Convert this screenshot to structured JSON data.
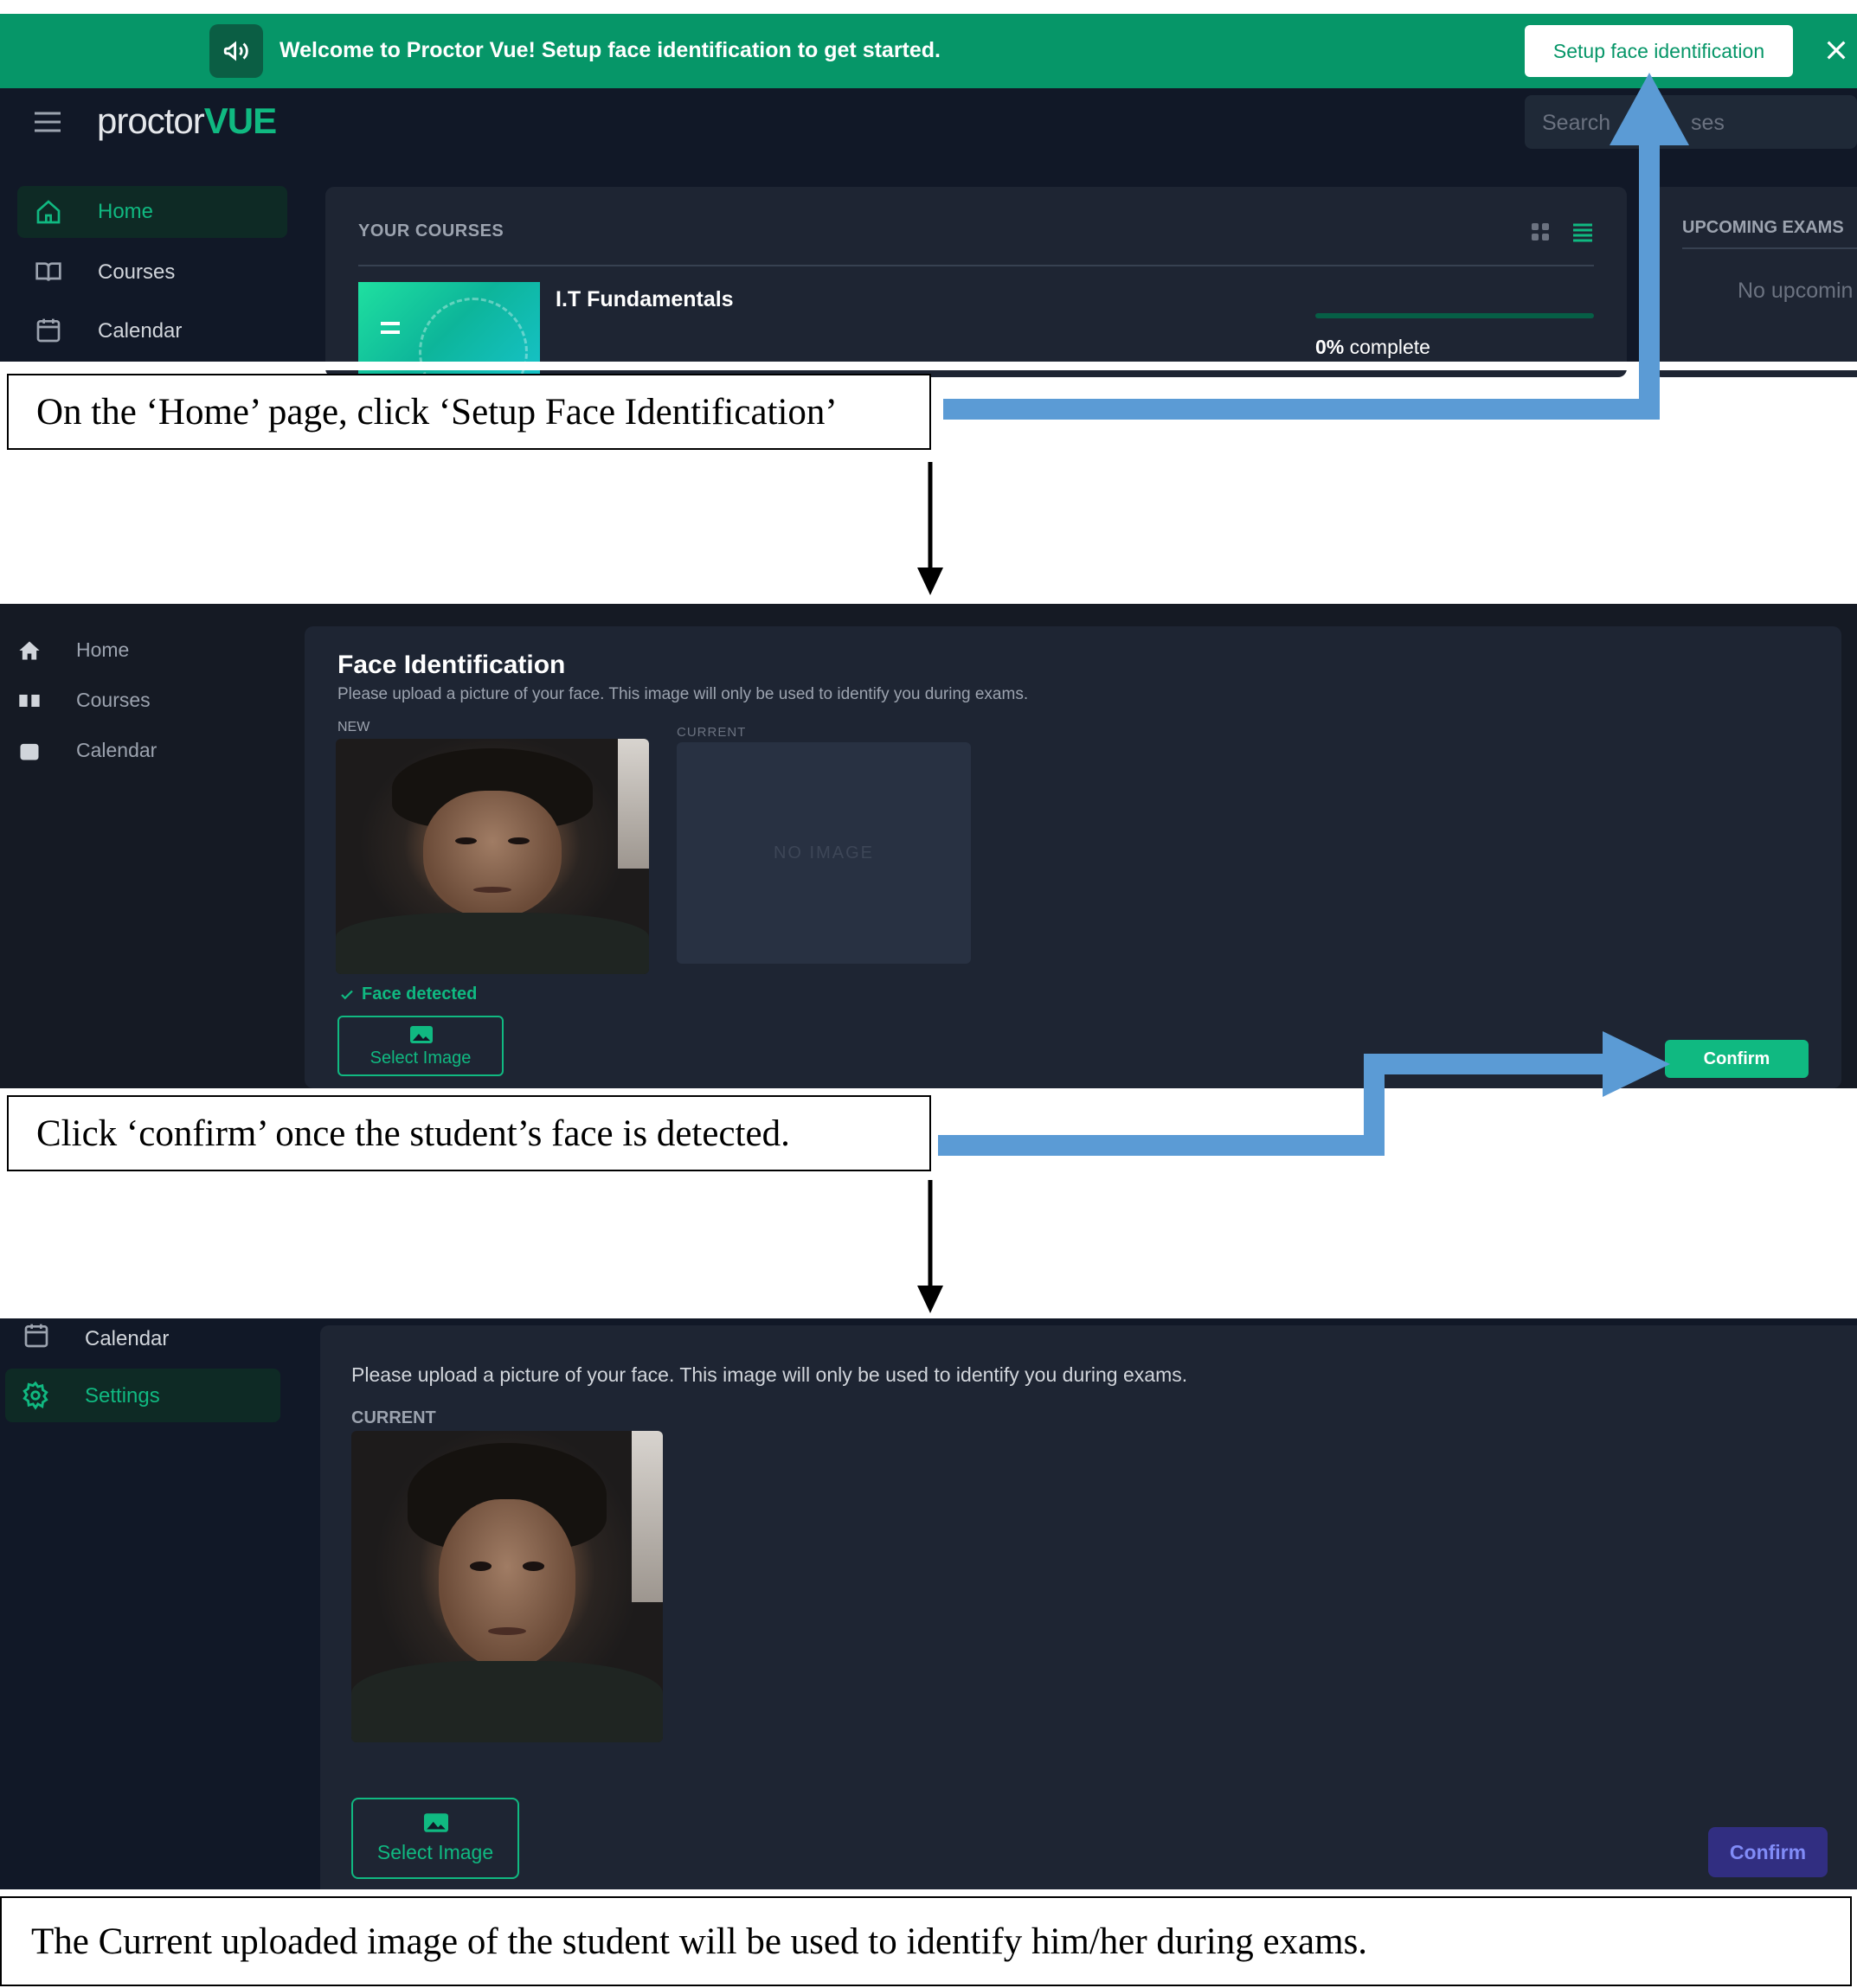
{
  "section1": {
    "banner": {
      "text": "Welcome to Proctor Vue! Setup face identification to get started.",
      "button": "Setup face identification"
    },
    "logo": {
      "part1": "proctor",
      "part2": "VUE"
    },
    "search_placeholder": "Search courses",
    "search_visible_start": "Search",
    "search_visible_end": "ses",
    "sidebar": [
      "Home",
      "Courses",
      "Calendar"
    ],
    "courses": {
      "header": "YOUR COURSES",
      "course_name": "I.T Fundamentals",
      "progress_pct_text": "0%",
      "progress_suffix": "complete",
      "progress": 0
    },
    "upcoming": {
      "header": "UPCOMING EXAMS",
      "empty": "No upcomin"
    }
  },
  "caption1": "On the ‘Home’ page, click ‘Setup Face Identification’",
  "section2": {
    "sidebar": [
      "Home",
      "Courses",
      "Calendar"
    ],
    "title": "Face Identification",
    "subtitle": "Please upload a picture of your face. This image will only be used to identify you during exams.",
    "new_label": "NEW",
    "current_label": "CURRENT",
    "no_image": "NO IMAGE",
    "face_detected": "Face detected",
    "select_image": "Select Image",
    "confirm": "Confirm"
  },
  "caption2": "Click ‘confirm’ once the student’s face is detected.",
  "section3": {
    "sidebar": [
      "Calendar",
      "Settings"
    ],
    "subtitle": "Please upload a picture of your face. This image will only be used to identify you during exams.",
    "current_label": "CURRENT",
    "select_image": "Select Image",
    "confirm": "Confirm"
  },
  "caption3": "The Current uploaded image of the student will be used to identify him/her during exams.",
  "colors": {
    "brand_green": "#069668",
    "accent_green": "#10b981",
    "bg_dark": "#111827",
    "panel": "#1e2533",
    "arrow_blue": "#5b9bd5",
    "confirm_purple": "#4338ca"
  }
}
